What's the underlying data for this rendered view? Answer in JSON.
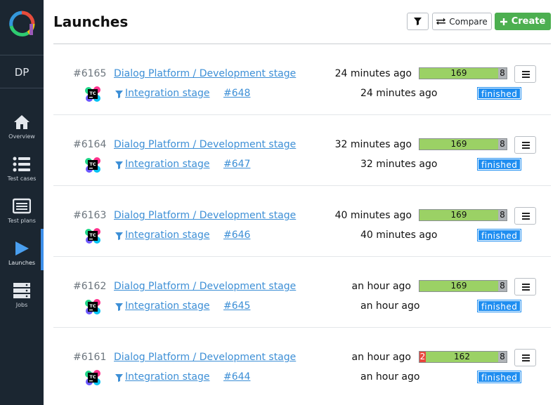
{
  "sidebar": {
    "project": "DP",
    "items": [
      {
        "label": "Overview"
      },
      {
        "label": "Test cases"
      },
      {
        "label": "Test plans"
      },
      {
        "label": "Launches"
      },
      {
        "label": "Jobs"
      }
    ]
  },
  "header": {
    "title": "Launches",
    "compare_label": "Compare",
    "create_label": "Create"
  },
  "colors": {
    "accent": "#3d8fea",
    "create": "#4caf50",
    "passed": "#9bd165",
    "failed": "#e8473e",
    "skipped": "#b0b4b8",
    "finished": "#1f8ef1"
  },
  "launches": [
    {
      "id": "#6165",
      "name": "Dialog Platform / Development stage",
      "time": "24 minutes ago",
      "failed": "",
      "passed": "169",
      "skipped": "8",
      "job": "Integration stage",
      "build": "#648",
      "job_time": "24 minutes ago",
      "status": "finished"
    },
    {
      "id": "#6164",
      "name": "Dialog Platform / Development stage",
      "time": "32 minutes ago",
      "failed": "",
      "passed": "169",
      "skipped": "8",
      "job": "Integration stage",
      "build": "#647",
      "job_time": "32 minutes ago",
      "status": "finished"
    },
    {
      "id": "#6163",
      "name": "Dialog Platform / Development stage",
      "time": "40 minutes ago",
      "failed": "",
      "passed": "169",
      "skipped": "8",
      "job": "Integration stage",
      "build": "#646",
      "job_time": "40 minutes ago",
      "status": "finished"
    },
    {
      "id": "#6162",
      "name": "Dialog Platform / Development stage",
      "time": "an hour ago",
      "failed": "",
      "passed": "169",
      "skipped": "8",
      "job": "Integration stage",
      "build": "#645",
      "job_time": "an hour ago",
      "status": "finished"
    },
    {
      "id": "#6161",
      "name": "Dialog Platform / Development stage",
      "time": "an hour ago",
      "failed": "2",
      "passed": "162",
      "skipped": "8",
      "job": "Integration stage",
      "build": "#644",
      "job_time": "an hour ago",
      "status": "finished"
    }
  ]
}
